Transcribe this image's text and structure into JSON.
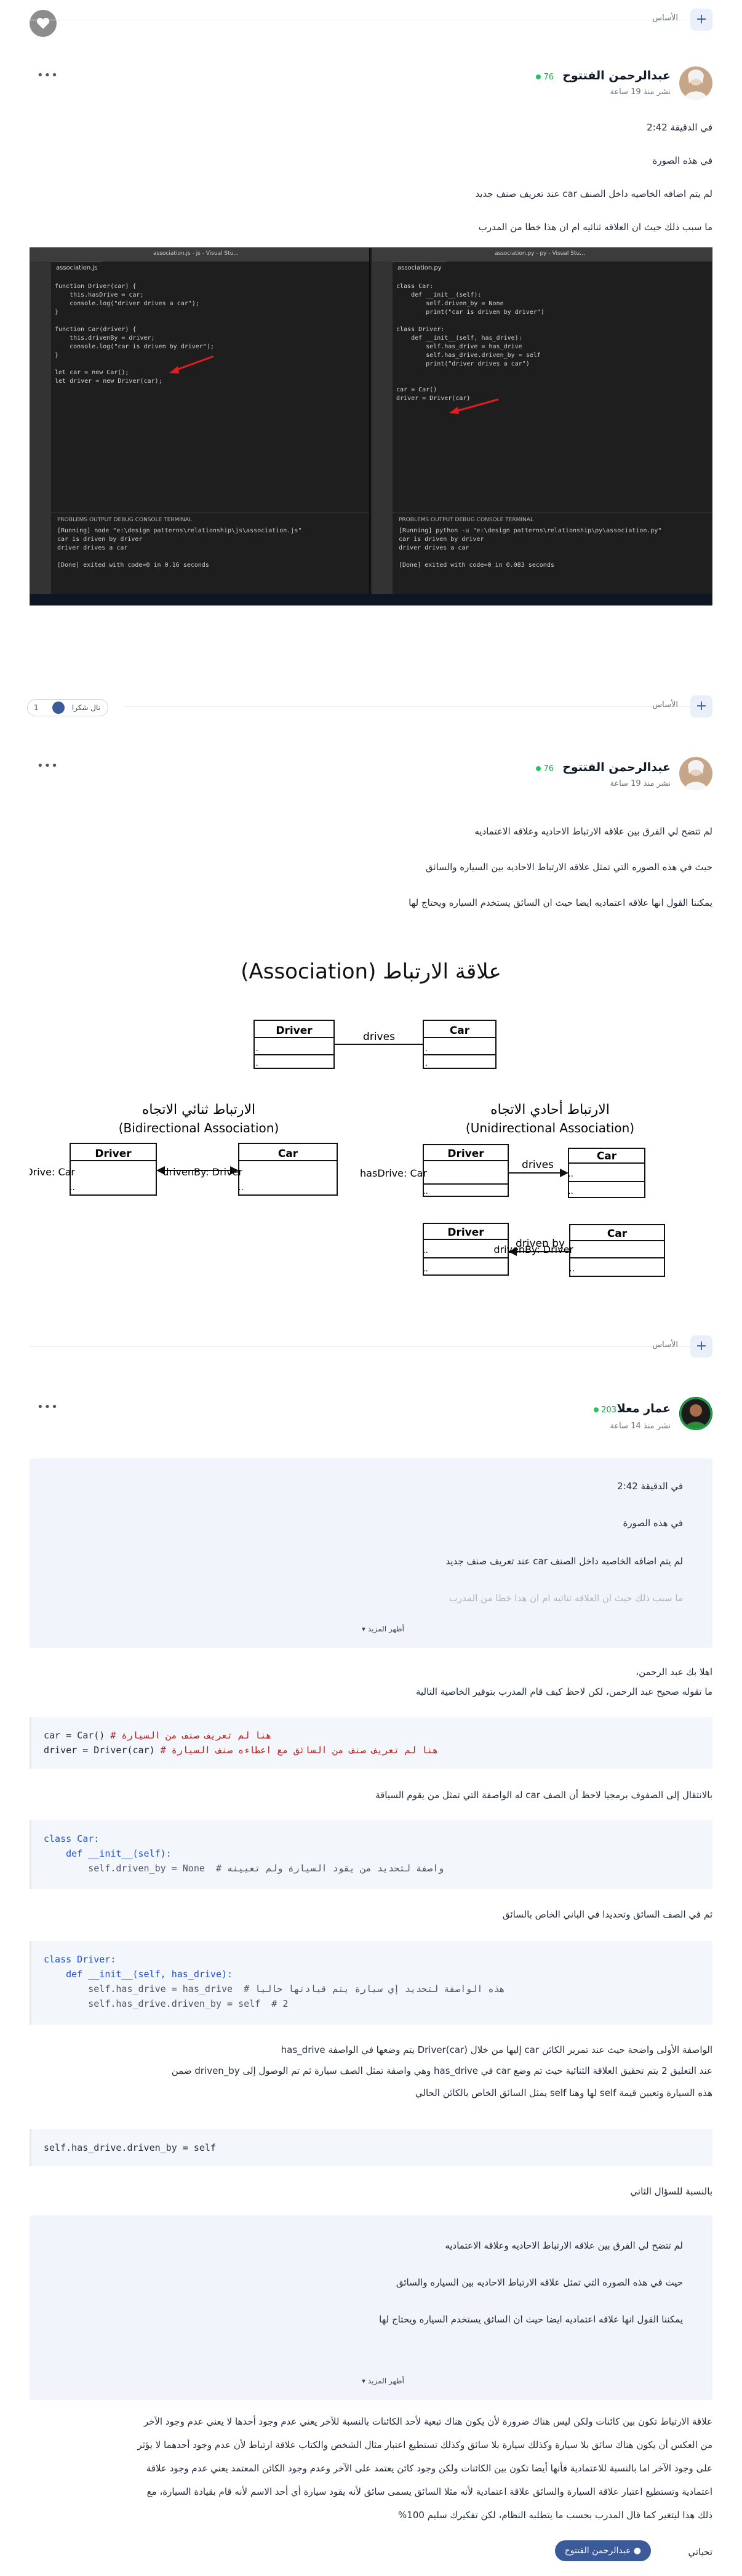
{
  "breadcrumb_label": "الأساس",
  "posts": [
    {
      "author": "عبدالرحمن الفتتوح",
      "points": "76",
      "time": "نشر منذ 19 ساعة",
      "lines": [
        "في الدقيقة 2:42",
        "في هذه الصورة",
        "لم يتم اضافه الخاصيه داخل الصنف car عند تعريف صنف جديد",
        "ما سبب ذلك حيث ان العلاقه ثنائيه ام ان هذا خطا من المدرب"
      ],
      "like_count": "1",
      "like_label": "نال شكرا"
    },
    {
      "author": "عبدالرحمن الفتتوح",
      "points": "76",
      "time": "نشر منذ 19 ساعة",
      "lines": [
        "لم تتضح لي الفرق بين علاقه الارتباط الاحاديه وعلاقه الاعتماديه",
        "حيث في هذه الصوره التي تمثل علاقه الارتباط الاحاديه بين السياره والسائق",
        "يمكننا القول انها علاقه اعتماديه ايضا حيث ان السائق يستخدم السياره ويحتاج لها"
      ]
    },
    {
      "author": "عمار معلا",
      "points": "203",
      "time": "نشر منذ 14 ساعة",
      "quote1": [
        "في الدقيقة 2:42",
        "في هذه الصورة",
        "لم يتم اضافه الخاصيه داخل الصنف car عند تعريف صنف جديد",
        "ما سبب ذلك حيث ان العلاقه ثنائيه ام ان هذا خطا من المدرب"
      ],
      "show_more": "أظهر المزيد",
      "greeting": "اهلا بك عبد الرحمن،",
      "intro": "ما تقوله صحيح عبد الرحمن، لكن لاحظ كيف قام المدرب بتوفير الخاصية التالية",
      "p_after_code1": "بالانتقال إلى الصفوف برمجيا لاحظ أن الصف car له الواصفة التي تمثل من يقوم السياقة",
      "p_after_code2": "ثم في الصف السائق وتحديدا في الباني الخاص بالسائق",
      "p_explain": [
        "الواصفة الأولى واضحة حيث عند تمرير الكائن car إليها من خلال Driver(car) يتم وضعها في الواصفة has_drive",
        "عند التعليق 2 يتم تحقيق العلاقة الثنائية حيث تم وضع car في has_drive وهي واصفة تمثل الصف سيارة ثم تم الوصول إلى driven_by ضمن",
        "هذه السيارة وتعيين قيمة self لها وهنا self يمثل السائق الخاص بالكائن الحالي"
      ],
      "p_second": "بالنسبة للسؤال الثاني",
      "quote2": [
        "لم تتضح لي الفرق بين علاقه الارتباط الاحاديه وعلاقه الاعتماديه",
        "حيث في هذه الصوره التي تمثل علاقه الارتباط الاحاديه بين السياره والسائق",
        "يمكننا القول انها علاقه اعتماديه ايضا حيث ان السائق يستخدم السياره ويحتاج لها"
      ],
      "p_final": [
        "علاقة الارتباط تكون بين كائنات ولكن ليس هناك ضرورة لأن يكون هناك تبعية لأحد الكائنات بالنسبة للآخر يعني عدم وجود أحدها لا يعني عدم وجود الآخر",
        "من العكس أن يكون هناك سائق بلا سيارة وكذلك سيارة بلا سائق وكذلك تستطيع اعتبار مثال الشخص والكتاب علاقة ارتباط لأن عدم وجود أحدهما لا يؤثر",
        "على وجود الآخر اما بالنسبة للاعتمادية فأنها أيضا تكون بين الكائنات ولكن وجود كائن يعتمد على الآخر وعدم وجود الكائن المعتمد يعني عدم وجود علاقة",
        "اعتمادية وتستطيع اعتبار علاقة السيارة والسائق علاقة اعتمادية لأنه مثلا السائق يسمى سائق لأنه يقود سيارة أي أحد الاسم لأنه قام بقيادة السيارة، مع",
        "ذلك هذا ليتغير كما قال المدرب بحسب ما يتطلبه النظام، لكن تفكيرك سليم 100%"
      ],
      "sign": "تحياتي",
      "reply_pill": "عبدالرحمن الفتتوح"
    }
  ],
  "code_blocks": {
    "one": [
      {
        "a": "car = Car()",
        "b": " # هنا لم تعريف صنف من السيارة"
      },
      {
        "a": "driver = Driver(car)",
        "b": " # هنا لم تعريف صنف من السائق مع اعطاءه صنف السيارة"
      }
    ],
    "two": [
      "class Car:",
      "    def __init__(self):",
      "        self.driven_by = None  # واصفة لتحديد من يقود السيارة ولم تعيينه"
    ],
    "three": [
      "class Driver:",
      "    def __init__(self, has_drive):",
      "        self.has_drive = has_drive  # هذه الواصفة لتحديد إي سيارة يتم قيادتها حاليا",
      "        self.has_drive.driven_by = self  # 2"
    ],
    "four": "self.has_drive.driven_by = self"
  },
  "vscode": {
    "left_title": "association.js - js - Visual Stu...",
    "right_title": "association.py - py - Visual Stu...",
    "left_tab": "association.js",
    "right_tab": "association.py",
    "left_code": [
      "function Driver(car) {",
      "    this.hasDrive = car;",
      "    console.log(\"driver drives a car\");",
      "}",
      "",
      "function Car(driver) {",
      "    this.drivenBy = driver;",
      "    console.log(\"car is driven by driver\");",
      "}",
      "",
      "let car = new Car();",
      "let driver = new Driver(car);"
    ],
    "right_code": [
      "class Car:",
      "    def __init__(self):",
      "        self.driven_by = None",
      "        print(\"car is driven by driver\")",
      "",
      "class Driver:",
      "    def __init__(self, has_drive):",
      "        self.has_drive = has_drive",
      "        self.has_drive.driven_by = self",
      "        print(\"driver drives a car\")",
      "",
      "",
      "car = Car()",
      "driver = Driver(car)",
      ""
    ],
    "panel_tabs": "PROBLEMS    OUTPUT    DEBUG CONSOLE    TERMINAL",
    "panel_select": "Code",
    "left_out": [
      "[Running] node \"e:\\design patterns\\relationship\\js\\association.js\"",
      "car is driven by driver",
      "driver drives a car",
      "",
      "[Done] exited with code=0 in 0.16 seconds"
    ],
    "right_out": [
      "[Running] python -u \"e:\\design patterns\\relationship\\py\\association.py\"",
      "car is driven by driver",
      "driver drives a car",
      "",
      "[Done] exited with code=0 in 0.083 seconds"
    ]
  },
  "diagram": {
    "title": "علاقة الارتباط (Association)",
    "top_left": "Driver",
    "top_right": "Car",
    "top_link": "drives",
    "bi_title": "الارتباط ثنائي الاتجاه",
    "bi_sub": "(Bidirectional Association)",
    "bi_driver": "Driver",
    "bi_driver_attr": "hasDrive: Car",
    "bi_car": "Car",
    "bi_car_attr": "drivenBy: Driver",
    "uni_title": "الارتباط أحادي الاتجاه",
    "uni_sub": "(Unidirectional Association)",
    "u1_driver": "Driver",
    "u1_driver_attr": "hasDrive: Car",
    "u1_car": "Car",
    "u1_link": "drives",
    "u2_driver": "Driver",
    "u2_car": "Car",
    "u2_car_attr": "drivenBy: Driver",
    "u2_link": "driven by",
    "dots": ".."
  },
  "colors": {
    "accent": "#3b5a9a",
    "online": "#22c55e",
    "quote_bg": "#f1f5fb"
  }
}
